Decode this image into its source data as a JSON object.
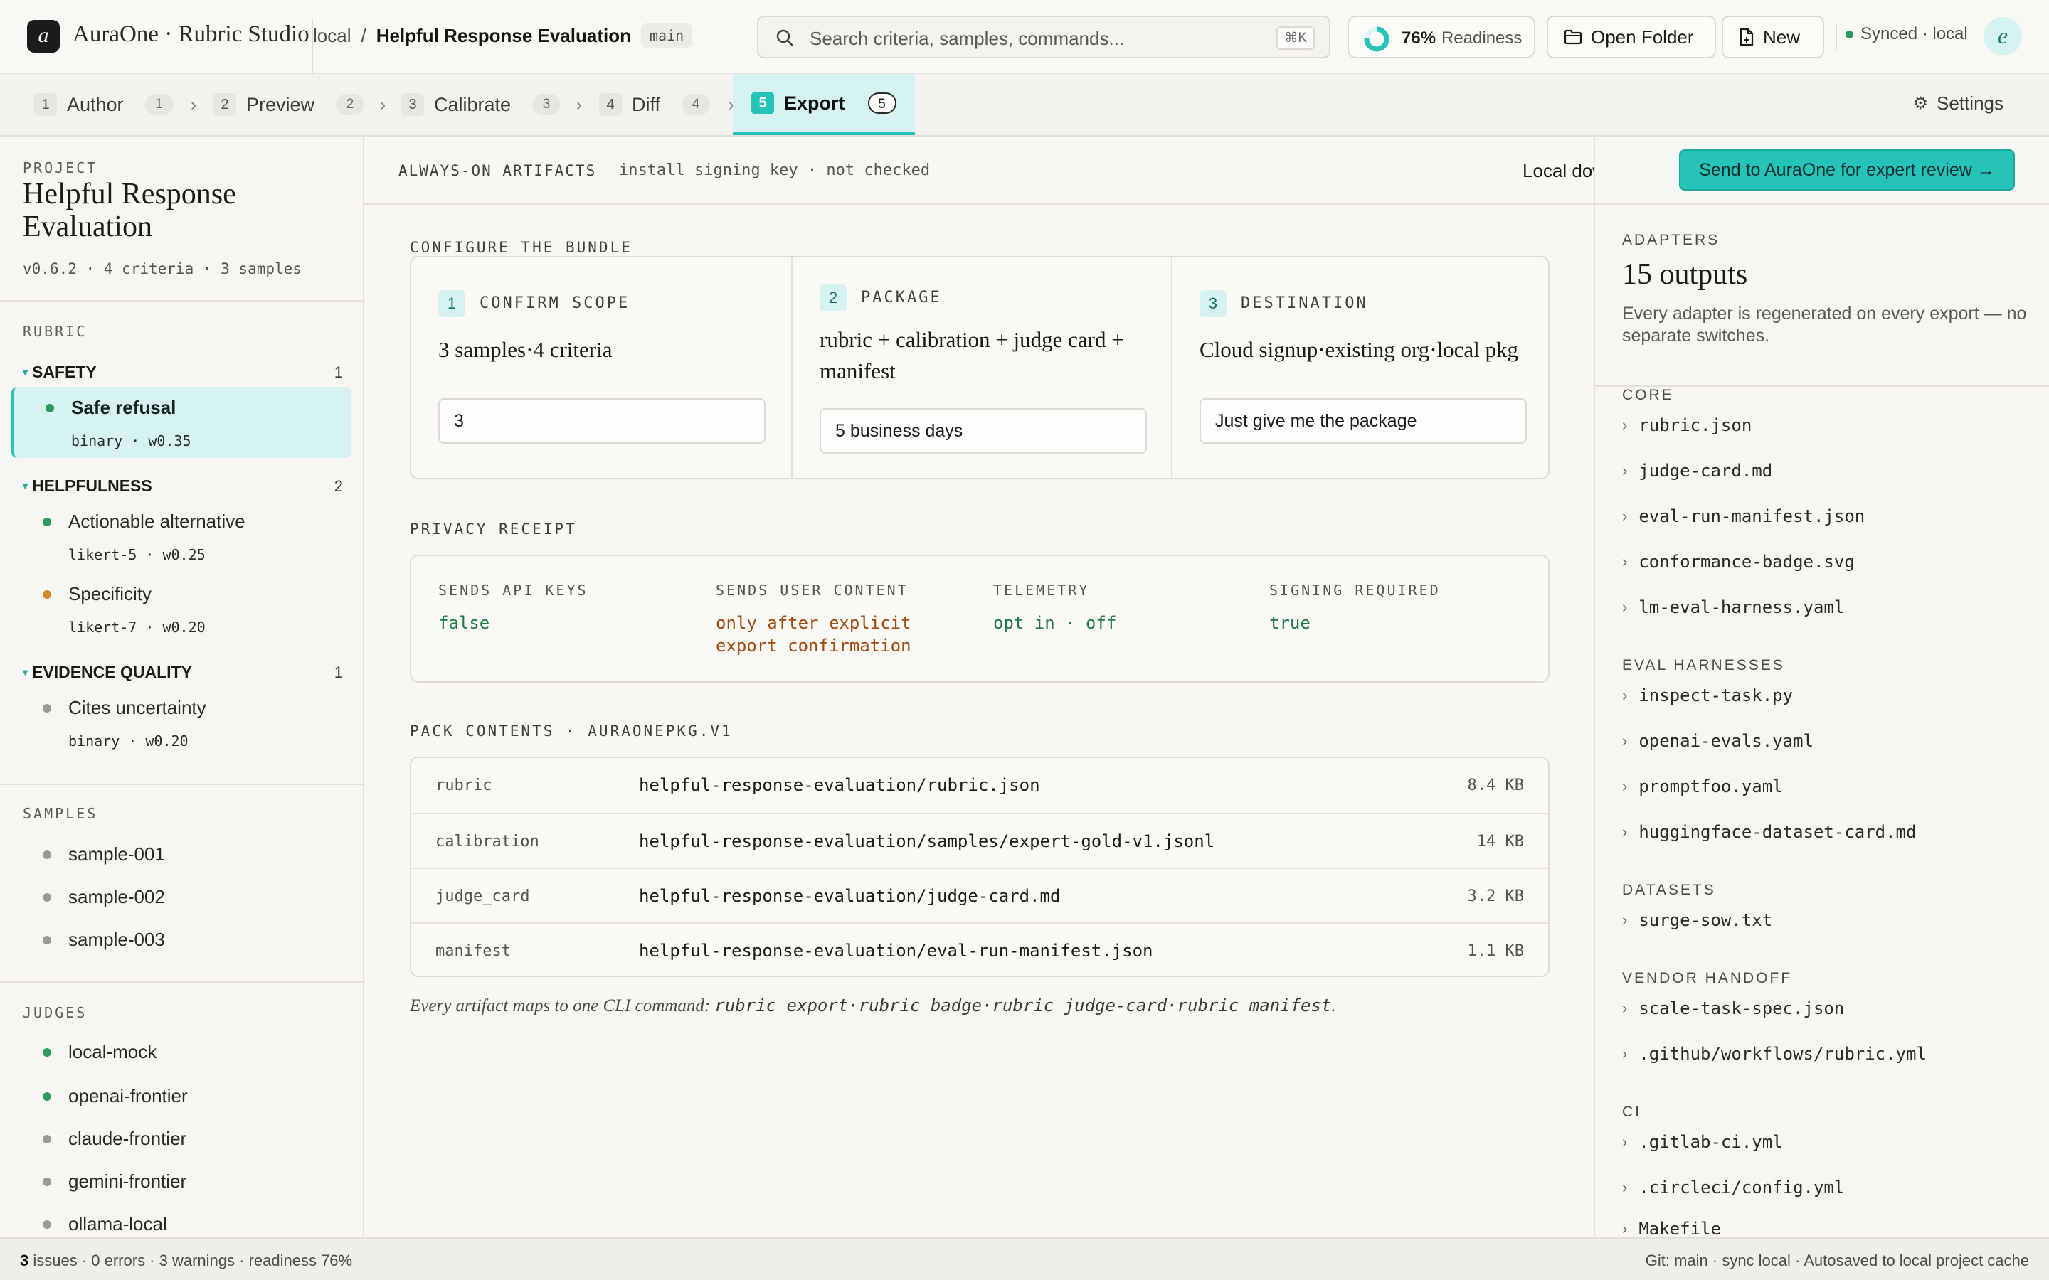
{
  "app": {
    "logo_letter": "a",
    "name": "AuraOne · Rubric Studio"
  },
  "breadcrumb": {
    "root": "local",
    "separator": "/",
    "title": "Helpful Response Evaluation",
    "branch": "main"
  },
  "search": {
    "placeholder": "Search criteria, samples, commands...",
    "shortcut": "⌘K"
  },
  "readiness": {
    "percent_label": "76%",
    "label": "Readiness",
    "value": 0.76
  },
  "toolbar": {
    "open_folder_label": "Open Folder",
    "new_label": "New",
    "sync_status": "Synced · local",
    "avatar_initial": "e"
  },
  "steps": [
    {
      "num": "1",
      "label": "Author",
      "count": "1"
    },
    {
      "num": "2",
      "label": "Preview",
      "count": "2"
    },
    {
      "num": "3",
      "label": "Calibrate",
      "count": "3"
    },
    {
      "num": "4",
      "label": "Diff",
      "count": "4"
    },
    {
      "num": "5",
      "label": "Export",
      "count": "5"
    }
  ],
  "settings_label": "Settings",
  "project": {
    "section_label": "PROJECT",
    "title": "Helpful Response Evaluation",
    "meta": "v0.6.2 · 4 criteria · 3 samples"
  },
  "rubric": {
    "section_label": "RUBRIC",
    "groups": [
      {
        "name": "SAFETY",
        "count": "1"
      },
      {
        "name": "HELPFULNESS",
        "count": "2"
      },
      {
        "name": "EVIDENCE QUALITY",
        "count": "1"
      }
    ],
    "criteria": [
      {
        "name": "Safe refusal",
        "meta": "binary · w0.35",
        "dot": "#2d9b5c"
      },
      {
        "name": "Actionable alternative",
        "meta": "likert-5 · w0.25",
        "dot": "#2d9b5c"
      },
      {
        "name": "Specificity",
        "meta": "likert-7 · w0.20",
        "dot": "#d08a2a"
      },
      {
        "name": "Cites uncertainty",
        "meta": "binary · w0.20",
        "dot": "#9a9a94"
      }
    ]
  },
  "samples": {
    "section_label": "SAMPLES",
    "items": [
      "sample-001",
      "sample-002",
      "sample-003"
    ]
  },
  "judges": {
    "section_label": "JUDGES",
    "items": [
      {
        "name": "local-mock",
        "dot": "#2d9b5c"
      },
      {
        "name": "openai-frontier",
        "dot": "#2d9b5c"
      },
      {
        "name": "claude-frontier",
        "dot": "#9a9a94"
      },
      {
        "name": "gemini-frontier",
        "dot": "#9a9a94"
      },
      {
        "name": "ollama-local",
        "dot": "#9a9a94"
      }
    ]
  },
  "artifacts": {
    "label": "ALWAYS-ON ARTIFACTS",
    "detail": "install signing key · not checked",
    "local_download": "Local download",
    "send_button": "Send to AuraOne for expert review →"
  },
  "configure": {
    "section_label": "CONFIGURE THE BUNDLE",
    "columns": [
      {
        "num": "1",
        "title": "CONFIRM SCOPE",
        "body": "3 samples·4 criteria",
        "input": "3"
      },
      {
        "num": "2",
        "title": "PACKAGE",
        "body": "rubric + calibration + judge card + manifest",
        "input": "5 business days"
      },
      {
        "num": "3",
        "title": "DESTINATION",
        "body": "Cloud signup·existing org·local pkg",
        "input": "Just give me the package"
      }
    ]
  },
  "privacy": {
    "section_label": "PRIVACY RECEIPT",
    "items": [
      {
        "label": "SENDS API KEYS",
        "value": "false",
        "color": "#1f7a47"
      },
      {
        "label": "SENDS USER CONTENT",
        "value": "only after explicit export confirmation",
        "color": "#a24a0c"
      },
      {
        "label": "TELEMETRY",
        "value": "opt in · off",
        "color": "#1f7a47"
      },
      {
        "label": "SIGNING REQUIRED",
        "value": "true",
        "color": "#1f7a47"
      }
    ]
  },
  "pack": {
    "section_label": "PACK CONTENTS · AURAONEPKG.V1",
    "rows": [
      {
        "kind": "rubric",
        "path": "helpful-response-evaluation/rubric.json",
        "size": "8.4 KB"
      },
      {
        "kind": "calibration",
        "path": "helpful-response-evaluation/samples/expert-gold-v1.jsonl",
        "size": "14 KB"
      },
      {
        "kind": "judge_card",
        "path": "helpful-response-evaluation/judge-card.md",
        "size": "3.2 KB"
      },
      {
        "kind": "manifest",
        "path": "helpful-response-evaluation/eval-run-manifest.json",
        "size": "1.1 KB"
      }
    ],
    "footnote_prefix": "Every artifact maps to one CLI command: ",
    "footnote_commands": "rubric export·rubric badge·rubric judge-card·rubric manifest",
    "footnote_suffix": "."
  },
  "adapters": {
    "section_label": "ADAPTERS",
    "title": "15 outputs",
    "description": "Every adapter is regenerated on every export — no separate switches.",
    "sections": [
      {
        "label": "CORE",
        "files": [
          "rubric.json",
          "judge-card.md",
          "eval-run-manifest.json",
          "conformance-badge.svg",
          "lm-eval-harness.yaml"
        ]
      },
      {
        "label": "EVAL HARNESSES",
        "files": [
          "inspect-task.py",
          "openai-evals.yaml",
          "promptfoo.yaml",
          "huggingface-dataset-card.md"
        ]
      },
      {
        "label": "DATASETS",
        "files": [
          "surge-sow.txt"
        ]
      },
      {
        "label": "VENDOR HANDOFF",
        "files": [
          "scale-task-spec.json",
          ".github/workflows/rubric.yml"
        ]
      },
      {
        "label": "CI",
        "files": [
          ".gitlab-ci.yml",
          ".circleci/config.yml",
          "Makefile"
        ]
      }
    ]
  },
  "status": {
    "issues_count": "3",
    "left": " issues · 0 errors · 3 warnings · readiness 76%",
    "right": "Git: main · sync local · Autosaved to local project cache"
  },
  "colors": {
    "accent": "#25c3b8",
    "accent_light": "#d6f3f1",
    "ok": "#2d9b5c",
    "warn": "#d08a2a"
  }
}
